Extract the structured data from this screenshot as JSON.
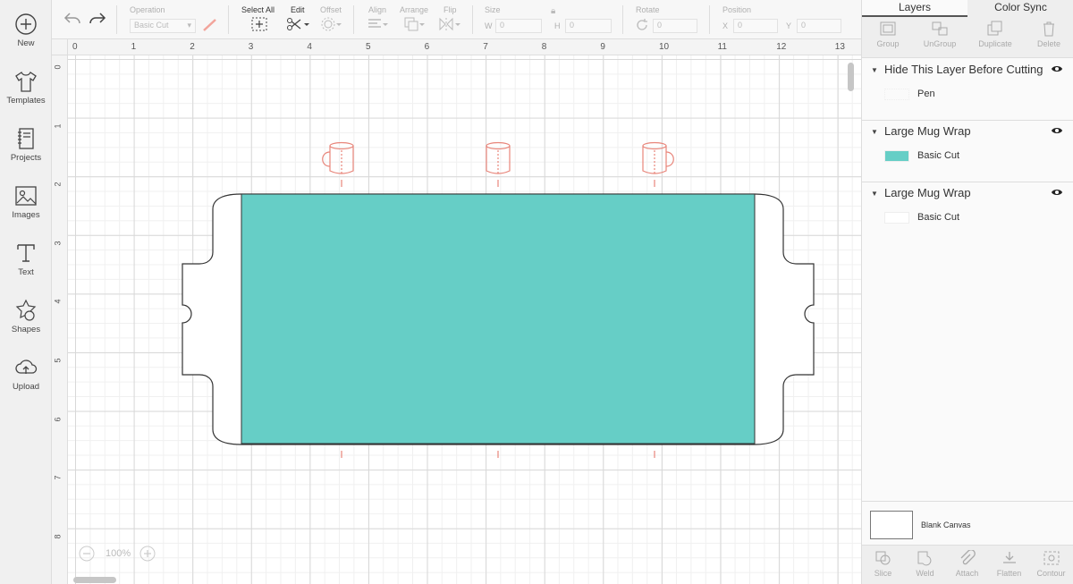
{
  "nav": {
    "new": "New",
    "templates": "Templates",
    "projects": "Projects",
    "images": "Images",
    "text": "Text",
    "shapes": "Shapes",
    "upload": "Upload"
  },
  "toolbar": {
    "operation_label": "Operation",
    "operation_value": "Basic Cut",
    "select_all": "Select All",
    "edit": "Edit",
    "offset": "Offset",
    "align": "Align",
    "arrange": "Arrange",
    "flip": "Flip",
    "size": "Size",
    "w": "W",
    "w_value": "0",
    "h": "H",
    "h_value": "0",
    "rotate": "Rotate",
    "rotate_value": "0",
    "position": "Position",
    "x": "X",
    "x_value": "0",
    "y": "Y",
    "y_value": "0"
  },
  "panel": {
    "tabs": [
      "Layers",
      "Color Sync"
    ],
    "actions": [
      "Group",
      "UnGroup",
      "Duplicate",
      "Delete"
    ],
    "layers": [
      {
        "title": "Hide This Layer Before Cutting",
        "sub": "Pen",
        "swatch": "#ffffff"
      },
      {
        "title": "Large Mug Wrap",
        "sub": "Basic Cut",
        "swatch": "#66cec6"
      },
      {
        "title": "Large Mug Wrap",
        "sub": "Basic Cut",
        "swatch": "#ffffff"
      }
    ],
    "blank_canvas": "Blank Canvas",
    "bottom_actions": [
      "Slice",
      "Weld",
      "Attach",
      "Flatten",
      "Contour"
    ]
  },
  "canvas": {
    "ruler_top": [
      "0",
      "1",
      "2",
      "3",
      "4",
      "5",
      "6",
      "7",
      "8",
      "9",
      "10",
      "11",
      "12",
      "13"
    ],
    "ruler_left": [
      "0",
      "1",
      "2",
      "3",
      "4",
      "5",
      "6",
      "7",
      "8"
    ],
    "zoom": "100%",
    "fill_color": "#66cec6",
    "pen_color": "#e8857a"
  }
}
